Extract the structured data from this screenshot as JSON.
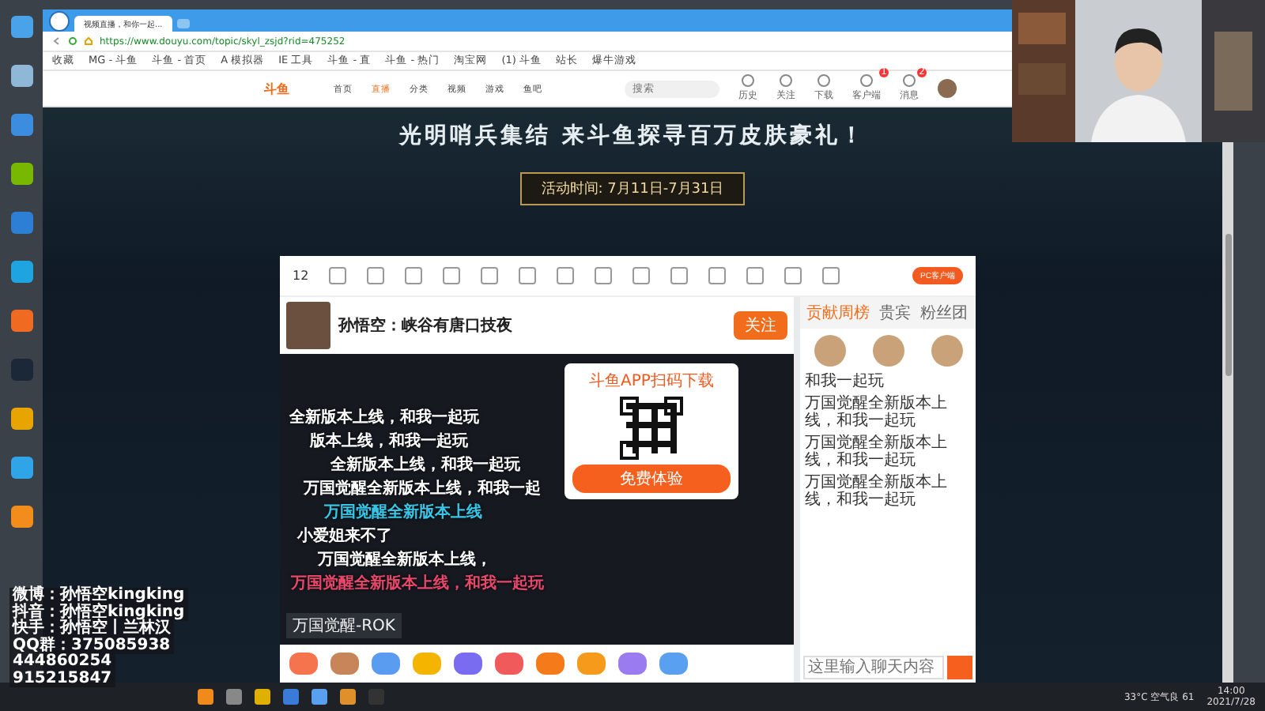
{
  "browser": {
    "tab_title": "视频直播，和你一起...",
    "url": "https://www.douyu.com/topic/skyl_zsjd?rid=475252",
    "bookmarks": [
      "收藏",
      "MG - 斗鱼",
      "斗鱼 - 首页",
      "A 模拟器",
      "IE 工具",
      "斗鱼 - 直",
      "斗鱼 - 热门",
      "淘宝网",
      "(1) 斗鱼",
      "站长",
      "爆牛游戏"
    ]
  },
  "site_nav": {
    "logo": "斗鱼",
    "items": [
      {
        "label": "首页",
        "selected": false
      },
      {
        "label": "直播",
        "selected": true
      },
      {
        "label": "分类",
        "selected": false
      },
      {
        "label": "视频",
        "selected": false
      },
      {
        "label": "游戏",
        "selected": false
      },
      {
        "label": "鱼吧",
        "selected": false
      }
    ],
    "search": {
      "placeholder": "搜索"
    },
    "icons": [
      {
        "label": "历史"
      },
      {
        "label": "关注"
      },
      {
        "label": "下载"
      },
      {
        "label": "客户端",
        "badge": "1"
      },
      {
        "label": "消息",
        "badge": "2"
      }
    ]
  },
  "banner": {
    "headline": "光明哨兵集结 来斗鱼探寻百万皮肤豪礼！",
    "dates": "活动时间: 7月11日-7月31日"
  },
  "stream_page": {
    "level": "12",
    "pc_client_button": "PC客户端",
    "streamer": {
      "title": "孙悟空：峡谷有唐口技夜",
      "follow_button": "关注"
    },
    "danmaku": [
      {
        "text": "全新版本上线，和我一起玩",
        "color": "#ffffff"
      },
      {
        "text": "版本上线，和我一起玩",
        "color": "#ffffff"
      },
      {
        "text": "全新版本上线，和我一起玩",
        "color": "#ffffff"
      },
      {
        "text": "万国觉醒全新版本上线，和我一起",
        "color": "#ffffff"
      },
      {
        "text": "万国觉醒全新版本上线",
        "color": "#35c6e8"
      },
      {
        "text": "小爱姐来不了",
        "color": "#ffffff"
      },
      {
        "text": "万国觉醒全新版本上线，",
        "color": "#ffffff"
      },
      {
        "text": "万国觉醒全新版本上线，和我一起玩",
        "color": "#e8466a"
      }
    ],
    "video_window_label": "万国觉醒-ROK",
    "qr_popup": {
      "title": "斗鱼APP扫码下载",
      "button": "免费体验"
    },
    "chat": {
      "tabs": [
        {
          "label": "贡献周榜",
          "selected": true
        },
        {
          "label": "贵宾",
          "selected": false
        },
        {
          "label": "粉丝团",
          "selected": false
        }
      ],
      "messages": [
        {
          "text": "和我一起玩"
        },
        {
          "text": "万国觉醒全新版本上线，和我一起玩"
        },
        {
          "text": "万国觉醒全新版本上线，和我一起玩"
        },
        {
          "text": "万国觉醒全新版本上线，和我一起玩"
        }
      ],
      "input": {
        "placeholder": "这里输入聊天内容"
      }
    }
  },
  "social_overlay": [
    "微博：孙悟空kingking",
    "抖音：孙悟空kingking",
    "快手：孙悟空丨兰林汉",
    "QQ群：375085938",
    "444860254",
    "915215847"
  ],
  "taskbar": {
    "weather": "33°C 空气良 61",
    "time": "14:00",
    "date": "2021/7/28"
  }
}
